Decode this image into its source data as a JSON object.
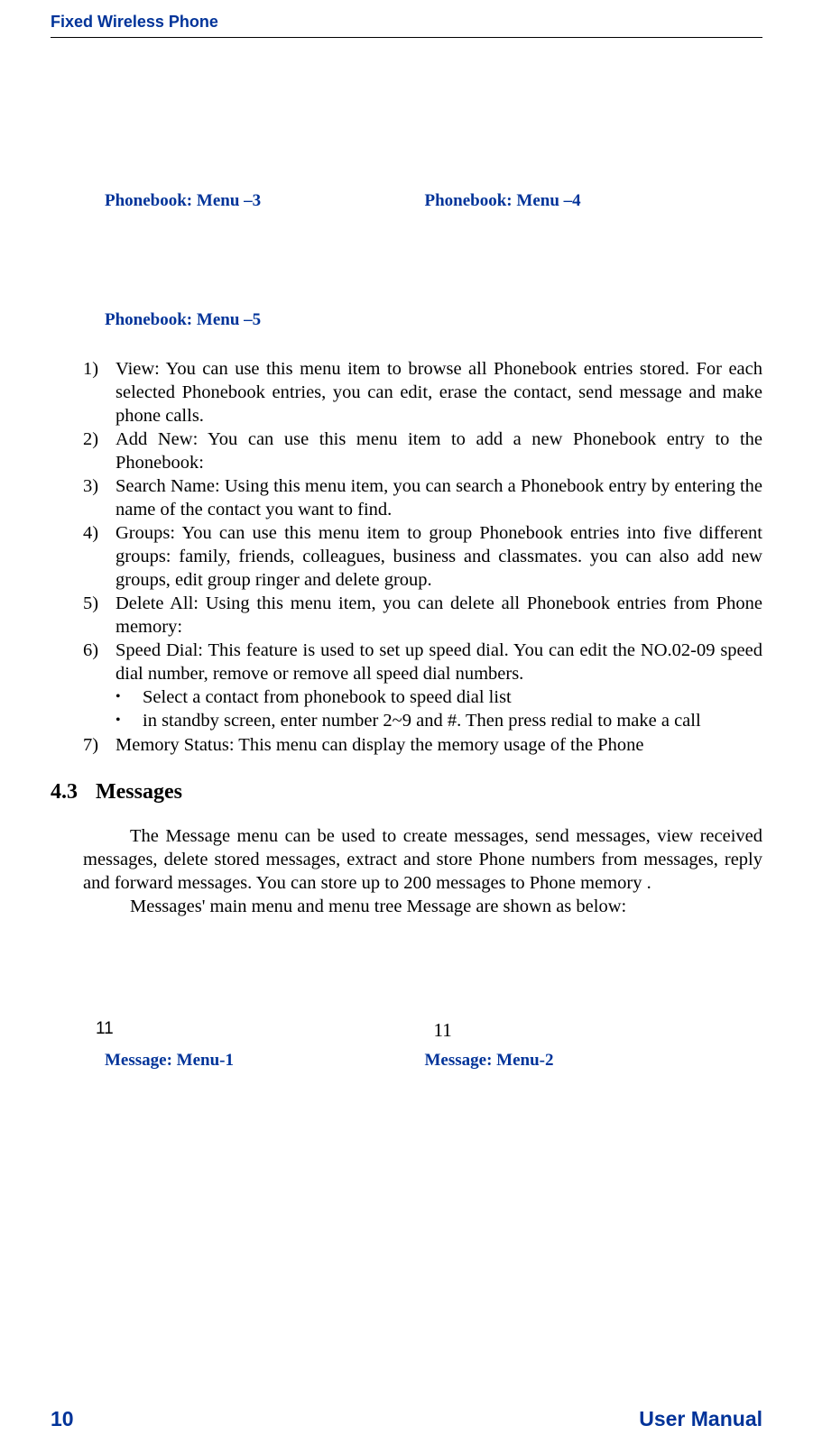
{
  "header": {
    "title": "Fixed Wireless Phone"
  },
  "captions": {
    "pb3": "Phonebook: Menu –3",
    "pb4": "Phonebook: Menu –4",
    "pb5": "Phonebook: Menu –5",
    "msg1": "Message: Menu-1",
    "msg2": "Message: Menu-2"
  },
  "list": {
    "n1": "1)",
    "t1": "View: You can use this menu item to browse all Phonebook entries stored. For each selected Phonebook entries, you can edit, erase  the contact, send message and make phone calls.",
    "n2": "2)",
    "t2": "Add New: You can use this menu item to add a new Phonebook entry to the Phonebook:",
    "n3": "3)",
    "t3": "Search Name: Using this menu item, you can search a Phonebook entry by entering the name of the contact you want to find.",
    "n4": "4)",
    "t4": "Groups:  You can use this menu item to group Phonebook entries into five different groups: family, friends, colleagues, business and classmates. you can also add new groups, edit group ringer and delete group.",
    "n5": "5)",
    "t5": "Delete All: Using this menu item, you can delete all Phonebook entries from Phone memory:",
    "n6": "6)",
    "t6": "Speed Dial: This feature is used to set up speed dial. You can edit the NO.02-09  speed dial number, remove or remove all speed dial numbers.",
    "b1": "Select a contact from phonebook to speed dial list",
    "b2": "in standby screen, enter  number 2~9 and #. Then press redial to make a call",
    "n7": "7)",
    "t7": "Memory Status: This menu can display the memory usage of the Phone"
  },
  "section": {
    "num": "4.3",
    "title": "Messages",
    "p1": "The Message menu can be used to create messages, send messages, view received messages, delete stored messages, extract and store Phone numbers from messages, reply and forward messages. You can store up to 200 messages to Phone memory .",
    "p2": "Messages' main menu and menu tree Message are shown as below:"
  },
  "misc": {
    "eleven_left": "11",
    "eleven_right": "11"
  },
  "footer": {
    "page": "10",
    "label": "User Manual"
  }
}
